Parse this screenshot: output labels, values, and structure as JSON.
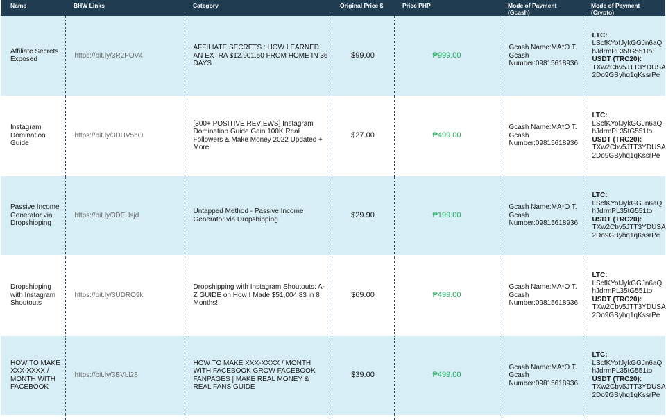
{
  "headers": {
    "name": "Name",
    "links": "BHW Links",
    "category": "Category",
    "original_price": "Original Price $",
    "price_php": "Price PHP",
    "gcash": "Mode of Payment (Gcash)",
    "crypto_line1": "Mode of Payment",
    "crypto_line2": "(Crypto)"
  },
  "colors": {
    "header_bg": "#1f3c51",
    "row_alt_bg": "#d8eef6",
    "php_text": "#22a85b",
    "link_text": "#6b6b6b"
  },
  "rows": [
    {
      "name": "Affiliate Secrets Exposed",
      "link": "https://bit.ly/3R2POV4",
      "category": "AFFILIATE SECRETS : HOW I EARNED AN EXTRA $12,901.50 FROM HOME IN 36 DAYS",
      "original_price": "$99.00",
      "price_php": "₱999.00",
      "gcash_line1": "Gcash Name:MA*O T.",
      "gcash_line2": "Gcash",
      "gcash_line3": "Number:09815618936",
      "ltc_label": "LTC:",
      "ltc_1": "LScfKYofJykGGJn6aQ",
      "ltc_2": "hJdrmPL35tG551to",
      "usdt_label": "USDT (TRC20):",
      "usdt_1": "TXw2Cbv5JTT3YDUSA",
      "usdt_2": "2Do9GByhq1qKssrPe"
    },
    {
      "name": "Instagram Domination Guide",
      "link": "https://bit.ly/3DHV5hO",
      "category": "[300+ POSITIVE REVIEWS] Instagram Domination Guide  Gain 100K Real Followers & Make Money 2022 Updated + More!",
      "original_price": "$27.00",
      "price_php": "₱499.00",
      "gcash_line1": "Gcash Name:MA*O T.",
      "gcash_line2": "Gcash",
      "gcash_line3": "Number:09815618936",
      "ltc_label": "LTC:",
      "ltc_1": "LScfKYofJykGGJn6aQ",
      "ltc_2": "hJdrmPL35tG551to",
      "usdt_label": "USDT (TRC20):",
      "usdt_1": "TXw2Cbv5JTT3YDUSA",
      "usdt_2": "2Do9GByhq1qKssrPe"
    },
    {
      "name": "Passive Income Generator via Dropshipping",
      "link": "https://bit.ly/3DEHsjd",
      "category": "Untapped Method - Passive Income Generator via Dropshipping",
      "original_price": "$29.90",
      "price_php": "₱199.00",
      "gcash_line1": "Gcash Name:MA*O T.",
      "gcash_line2": "Gcash",
      "gcash_line3": "Number:09815618936",
      "ltc_label": "LTC:",
      "ltc_1": "LScfKYofJykGGJn6aQ",
      "ltc_2": "hJdrmPL35tG551to",
      "usdt_label": "USDT (TRC20):",
      "usdt_1": "TXw2Cbv5JTT3YDUSA",
      "usdt_2": "2Do9GByhq1qKssrPe"
    },
    {
      "name": "Dropshipping with Instagram Shoutouts",
      "link": "https://bit.ly/3UDRO9k",
      "category": "Dropshipping with Instagram Shoutouts: A-Z GUIDE on How I Made $51,004.83 in 8 Months!",
      "original_price": "$69.00",
      "price_php": "₱499.00",
      "gcash_line1": "Gcash Name:MA*O T.",
      "gcash_line2": "Gcash",
      "gcash_line3": "Number:09815618936",
      "ltc_label": "LTC:",
      "ltc_1": "LScfKYofJykGGJn6aQ",
      "ltc_2": "hJdrmPL35tG551to",
      "usdt_label": "USDT (TRC20):",
      "usdt_1": "TXw2Cbv5JTT3YDUSA",
      "usdt_2": "2Do9GByhq1qKssrPe"
    },
    {
      "name": "HOW TO MAKE XXX-XXXX / MONTH WITH FACEBOOK",
      "link": "https://bit.ly/3BVLl28",
      "category": "HOW TO MAKE XXX-XXXX / MONTH WITH FACEBOOK GROW FACEBOOK FANPAGES | MAKE REAL MONEY & REAL FANS GUIDE",
      "original_price": "$39.00",
      "price_php": "₱499.00",
      "gcash_line1": "Gcash Name:MA*O T.",
      "gcash_line2": "Gcash",
      "gcash_line3": "Number:09815618936",
      "ltc_label": "LTC:",
      "ltc_1": "LScfKYofJykGGJn6aQ",
      "ltc_2": "hJdrmPL35tG551to",
      "usdt_label": "USDT (TRC20):",
      "usdt_1": "TXw2Cbv5JTT3YDUSA",
      "usdt_2": "2Do9GByhq1qKssrPe"
    }
  ]
}
